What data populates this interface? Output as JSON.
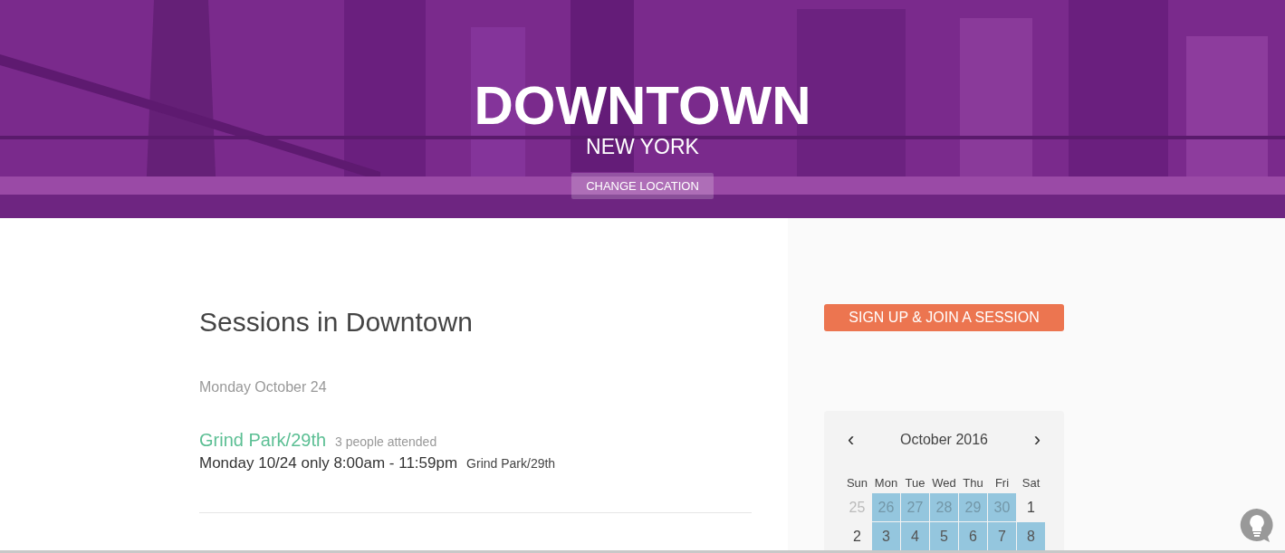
{
  "hero": {
    "title": "DOWNTOWN",
    "subtitle": "NEW YORK",
    "button": "CHANGE LOCATION"
  },
  "main": {
    "heading": "Sessions in Downtown",
    "groups": [
      {
        "date": "Monday October 24",
        "sessions": [
          {
            "name": "Grind Park/29th",
            "attendance": "3 people attended",
            "schedule": "Monday 10/24 only 8:00am - 11:59pm",
            "place": "Grind Park/29th"
          }
        ]
      }
    ]
  },
  "sidebar": {
    "cta": "SIGN UP & JOIN A SESSION",
    "calendar": {
      "prev": "‹",
      "title": "October 2016",
      "next": "›",
      "weekdays": [
        "Sun",
        "Mon",
        "Tue",
        "Wed",
        "Thu",
        "Fri",
        "Sat"
      ],
      "weeks": [
        [
          {
            "day": "25",
            "outside": true,
            "highlighted": false
          },
          {
            "day": "26",
            "outside": true,
            "highlighted": true
          },
          {
            "day": "27",
            "outside": true,
            "highlighted": true
          },
          {
            "day": "28",
            "outside": true,
            "highlighted": true
          },
          {
            "day": "29",
            "outside": true,
            "highlighted": true
          },
          {
            "day": "30",
            "outside": true,
            "highlighted": true
          },
          {
            "day": "1",
            "outside": false,
            "highlighted": false
          }
        ],
        [
          {
            "day": "2",
            "outside": false,
            "highlighted": false
          },
          {
            "day": "3",
            "outside": false,
            "highlighted": true
          },
          {
            "day": "4",
            "outside": false,
            "highlighted": true
          },
          {
            "day": "5",
            "outside": false,
            "highlighted": true
          },
          {
            "day": "6",
            "outside": false,
            "highlighted": true
          },
          {
            "day": "7",
            "outside": false,
            "highlighted": true
          },
          {
            "day": "8",
            "outside": false,
            "highlighted": true
          }
        ]
      ]
    }
  },
  "help": {
    "kind": "lightbulb"
  }
}
